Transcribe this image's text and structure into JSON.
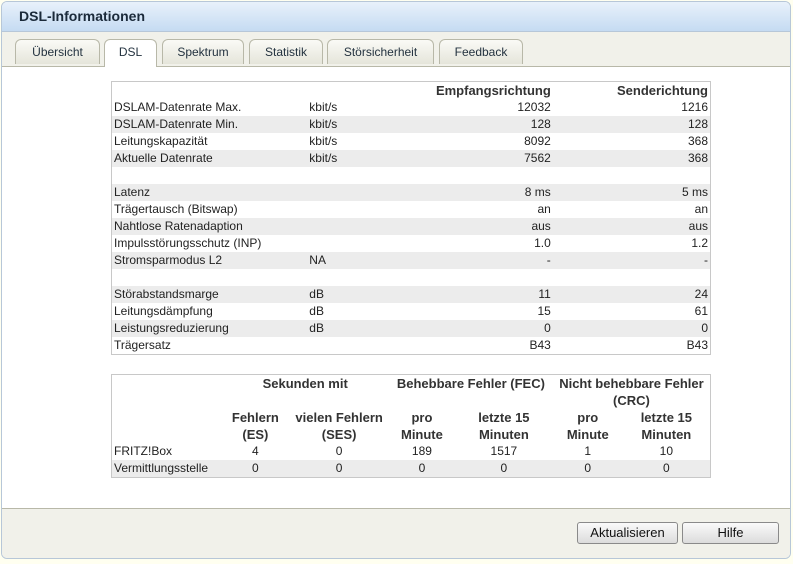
{
  "window": {
    "title": "DSL-Informationen"
  },
  "tabs": [
    {
      "label": "Übersicht"
    },
    {
      "label": "DSL"
    },
    {
      "label": "Spektrum"
    },
    {
      "label": "Statistik"
    },
    {
      "label": "Störsicherheit"
    },
    {
      "label": "Feedback"
    }
  ],
  "active_tab": "DSL",
  "info_table": {
    "headers": {
      "empfang": "Empfangsrichtung",
      "sende": "Senderichtung"
    },
    "rows": [
      {
        "label": "DSLAM-Datenrate Max.",
        "unit": "kbit/s",
        "empfang": "12032",
        "sende": "1216"
      },
      {
        "label": "DSLAM-Datenrate Min.",
        "unit": "kbit/s",
        "empfang": "128",
        "sende": "128"
      },
      {
        "label": "Leitungskapazität",
        "unit": "kbit/s",
        "empfang": "8092",
        "sende": "368"
      },
      {
        "label": "Aktuelle Datenrate",
        "unit": "kbit/s",
        "empfang": "7562",
        "sende": "368"
      },
      {
        "label": "",
        "unit": "",
        "empfang": "",
        "sende": ""
      },
      {
        "label": "Latenz",
        "unit": "",
        "empfang": "8 ms",
        "sende": "5 ms"
      },
      {
        "label": "Trägertausch (Bitswap)",
        "unit": "",
        "empfang": "an",
        "sende": "an"
      },
      {
        "label": "Nahtlose Ratenadaption",
        "unit": "",
        "empfang": "aus",
        "sende": "aus"
      },
      {
        "label": "Impulsstörungsschutz (INP)",
        "unit": "",
        "empfang": "1.0",
        "sende": "1.2"
      },
      {
        "label": "Stromsparmodus L2",
        "unit": "NA",
        "empfang": "-",
        "sende": "-"
      },
      {
        "label": "",
        "unit": "",
        "empfang": "",
        "sende": ""
      },
      {
        "label": "Störabstandsmarge",
        "unit": "dB",
        "empfang": "11",
        "sende": "24"
      },
      {
        "label": "Leitungsdämpfung",
        "unit": "dB",
        "empfang": "15",
        "sende": "61"
      },
      {
        "label": "Leistungsreduzierung",
        "unit": "dB",
        "empfang": "0",
        "sende": "0"
      },
      {
        "label": "Trägersatz",
        "unit": "",
        "empfang": "B43",
        "sende": "B43"
      }
    ]
  },
  "error_table": {
    "groups": {
      "sekunden": "Sekunden mit",
      "fec": "Behebbare Fehler (FEC)",
      "crc": "Nicht behebbare Fehler (CRC)"
    },
    "subheaders": {
      "es": "Fehlern (ES)",
      "ses": "vielen Fehlern (SES)",
      "fec_pro": "pro Minute",
      "fec_15": "letzte 15 Minuten",
      "crc_pro": "pro Minute",
      "crc_15": "letzte 15 Minuten"
    },
    "rows": [
      {
        "label": "FRITZ!Box",
        "es": "4",
        "ses": "0",
        "fec_pro": "189",
        "fec_15": "1517",
        "crc_pro": "1",
        "crc_15": "10"
      },
      {
        "label": "Vermittlungsstelle",
        "es": "0",
        "ses": "0",
        "fec_pro": "0",
        "fec_15": "0",
        "crc_pro": "0",
        "crc_15": "0"
      }
    ]
  },
  "buttons": {
    "refresh": "Aktualisieren",
    "help": "Hilfe"
  }
}
